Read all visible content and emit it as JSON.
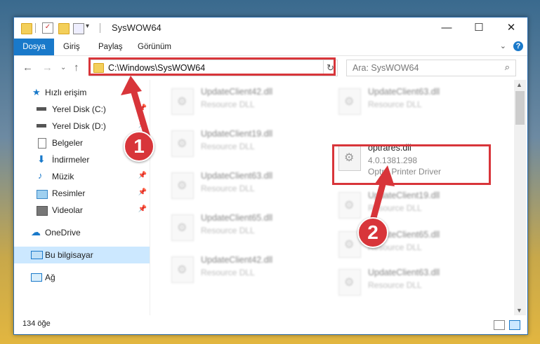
{
  "window": {
    "title": "SysWOW64",
    "controls": {
      "minimize": "—",
      "maximize": "☐",
      "close": "✕"
    }
  },
  "ribbon": {
    "tabs": [
      "Dosya",
      "Giriş",
      "Paylaş",
      "Görünüm"
    ],
    "help": "?"
  },
  "address": {
    "path": "C:\\Windows\\SysWOW64",
    "search_placeholder": "Ara: SysWOW64"
  },
  "nav": {
    "items": [
      {
        "label": "Hızlı erişim",
        "icon": "star-icon"
      },
      {
        "label": "Yerel Disk (C:)",
        "icon": "drive-icon",
        "pinned": true
      },
      {
        "label": "Yerel Disk (D:)",
        "icon": "drive-icon",
        "pinned": true
      },
      {
        "label": "Belgeler",
        "icon": "documents-icon",
        "pinned": true
      },
      {
        "label": "İndirmeler",
        "icon": "download-icon",
        "pinned": true
      },
      {
        "label": "Müzik",
        "icon": "music-icon",
        "pinned": true
      },
      {
        "label": "Resimler",
        "icon": "pictures-icon",
        "pinned": true
      },
      {
        "label": "Videolar",
        "icon": "videos-icon",
        "pinned": true
      },
      {
        "label": "OneDrive",
        "icon": "cloud-icon"
      },
      {
        "label": "Bu bilgisayar",
        "icon": "computer-icon",
        "selected": true
      },
      {
        "label": "Ağ",
        "icon": "network-icon"
      }
    ]
  },
  "files": {
    "left": [
      {
        "name": "UpdateClient42.dll",
        "type": "Resource DLL"
      },
      {
        "name": "UpdateClient19.dll",
        "type": "Resource DLL"
      },
      {
        "name": "UpdateClient63.dll",
        "type": "Resource DLL"
      },
      {
        "name": "UpdateClient65.dll",
        "type": "Resource DLL"
      },
      {
        "name": "UpdateClient42.dll",
        "type": "Resource DLL"
      }
    ],
    "right": [
      {
        "name": "UpdateClient63.dll",
        "type": "Resource DLL"
      },
      {
        "name": "optrares.dll",
        "version": "4.0.1381.298",
        "type": "Optra Printer Driver",
        "highlighted": true
      },
      {
        "name": "UpdateClient19.dll",
        "type": "Resource DLL"
      },
      {
        "name": "UpdateClient65.dll",
        "type": "Resource DLL"
      },
      {
        "name": "UpdateClient63.dll",
        "type": "Resource DLL"
      }
    ]
  },
  "status": {
    "count": "134 öğe"
  },
  "annotations": {
    "step1": "1",
    "step2": "2",
    "color": "#d8353a"
  }
}
